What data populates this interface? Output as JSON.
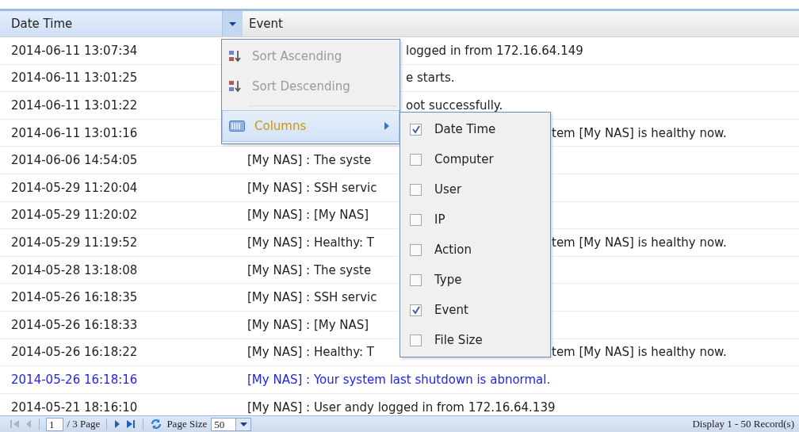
{
  "columns": [
    {
      "label": "Date Time",
      "selected": true
    },
    {
      "label": "Event",
      "selected": false
    }
  ],
  "column_menu": [
    {
      "kind": "sort-asc",
      "label": "Sort Ascending",
      "disabled": true,
      "selected": false
    },
    {
      "kind": "sort-desc",
      "label": "Sort Descending",
      "disabled": true,
      "selected": false
    },
    {
      "kind": "submenu",
      "label": "Columns",
      "disabled": false,
      "selected": true
    }
  ],
  "columns_submenu": [
    {
      "label": "Date Time",
      "checked": true
    },
    {
      "label": "Computer",
      "checked": false
    },
    {
      "label": "User",
      "checked": false
    },
    {
      "label": "IP",
      "checked": false
    },
    {
      "label": "Action",
      "checked": false
    },
    {
      "label": "Type",
      "checked": false
    },
    {
      "label": "Event",
      "checked": true
    },
    {
      "label": "File Size",
      "checked": false
    }
  ],
  "rows": [
    {
      "date": "2014-06-11 13:07:34",
      "event_tail": "logged in from 172.16.64.149",
      "kind": "normal"
    },
    {
      "date": "2014-06-11 13:01:25",
      "event_tail": "e starts.",
      "kind": "normal"
    },
    {
      "date": "2014-06-11 13:01:22",
      "event_tail": "oot successfully.",
      "kind": "normal"
    },
    {
      "date": "2014-06-11 13:01:16",
      "event_tail": "tem [My NAS] is healthy now.",
      "kind": "normal"
    },
    {
      "date": "2014-06-06 14:54:05",
      "event": "[My NAS] : The syste",
      "kind": "normal"
    },
    {
      "date": "2014-05-29 11:20:04",
      "event": "[My NAS] : SSH servic",
      "kind": "normal"
    },
    {
      "date": "2014-05-29 11:20:02",
      "event": "[My NAS] : [My NAS]",
      "kind": "normal"
    },
    {
      "date": "2014-05-29 11:19:52",
      "event": "[My NAS] : Healthy: T",
      "event_tail": "tem [My NAS] is healthy now.",
      "kind": "normal"
    },
    {
      "date": "2014-05-28 13:18:08",
      "event": "[My NAS] : The syste",
      "kind": "normal"
    },
    {
      "date": "2014-05-26 16:18:35",
      "event": "[My NAS] : SSH servic",
      "kind": "normal"
    },
    {
      "date": "2014-05-26 16:18:33",
      "event": "[My NAS] : [My NAS]",
      "kind": "normal"
    },
    {
      "date": "2014-05-26 16:18:22",
      "event": "[My NAS] : Healthy: T",
      "event_tail": "tem [My NAS] is healthy now.",
      "kind": "normal"
    },
    {
      "date": "2014-05-26 16:18:16",
      "event": "[My NAS] : Your system last shutdown is abnormal.",
      "kind": "warning"
    },
    {
      "date": "2014-05-21 18:16:10",
      "event": "[My NAS] : User andy logged in from 172.16.64.139",
      "kind": "normal"
    }
  ],
  "pager": {
    "at_first_page": true,
    "page": "1",
    "page_total": "/ 3 Page",
    "page_size_label": "Page Size",
    "page_size": "50",
    "display": "Display 1 - 50 Record(s)"
  }
}
